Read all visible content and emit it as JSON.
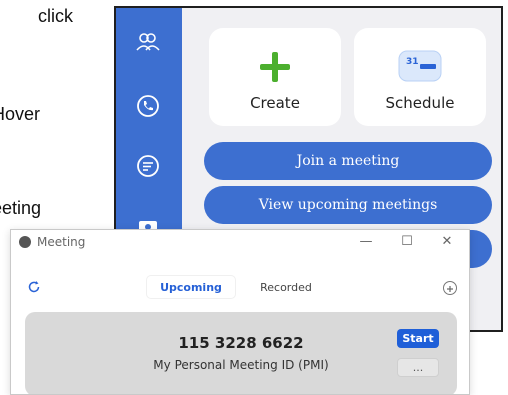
{
  "instructions": {
    "line1": "click",
    "line2": "Hover",
    "line3": "eeting"
  },
  "zoom_home": {
    "sidebar_icons": [
      "contacts-icon",
      "phone-icon",
      "chat-icon",
      "meetings-icon"
    ],
    "create": {
      "label": "Create",
      "icon": "plus-icon"
    },
    "schedule": {
      "label": "Schedule",
      "icon": "calendar-icon",
      "calendar_day": "31"
    },
    "join_label": "Join a meeting",
    "view_label": "View upcoming meetings"
  },
  "meeting_window": {
    "title": "Meeting",
    "controls": {
      "minimize": "—",
      "maximize": "☐",
      "close": "✕"
    },
    "tabs": [
      {
        "label": "Upcoming",
        "active": true
      },
      {
        "label": "Recorded",
        "active": false
      }
    ],
    "pmi": {
      "number": "115 3228 6622",
      "label": "My Personal Meeting ID (PMI)",
      "start_label": "Start",
      "more_label": "..."
    }
  },
  "colors": {
    "brand_blue": "#3d6fd0",
    "start_blue": "#1f5fd8",
    "create_green": "#4caf2e"
  }
}
